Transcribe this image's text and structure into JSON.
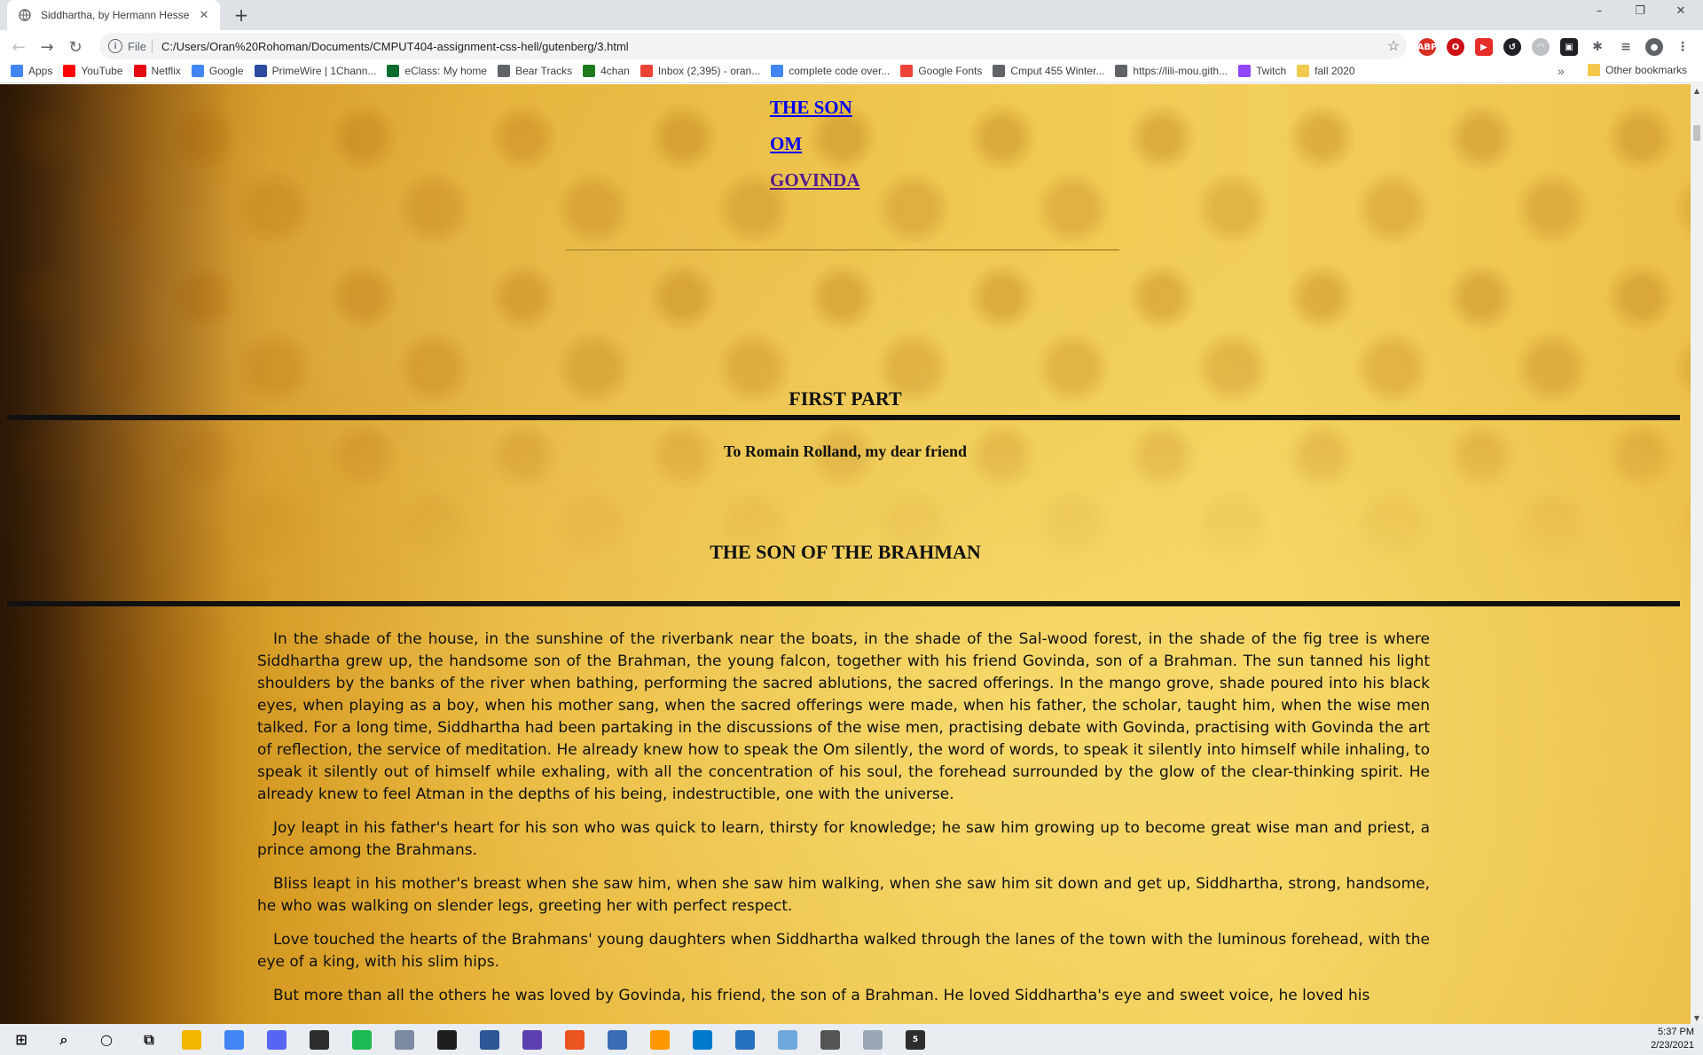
{
  "browser": {
    "tab_title": "Siddhartha, by Hermann Hesse",
    "new_tab_label": "+",
    "window_buttons": [
      "–",
      "❐",
      "✕"
    ],
    "url_scheme": "File",
    "url": "C:/Users/Oran%20Rohoman/Documents/CMPUT404-assignment-css-hell/gutenberg/3.html"
  },
  "bookmarks": [
    {
      "label": "Apps",
      "icon": "apps-grid-icon",
      "color": "#4285f4"
    },
    {
      "label": "YouTube",
      "icon": "youtube-icon",
      "color": "#ff0000"
    },
    {
      "label": "Netflix",
      "icon": "netflix-icon",
      "color": "#e50914"
    },
    {
      "label": "Google",
      "icon": "google-icon",
      "color": "#4285f4"
    },
    {
      "label": "PrimeWire | 1Chann...",
      "icon": "primewire-icon",
      "color": "#2b4aa0"
    },
    {
      "label": "eClass: My home",
      "icon": "eclass-icon",
      "color": "#0a6b2e"
    },
    {
      "label": "Bear Tracks",
      "icon": "globe-icon",
      "color": "#5f6368"
    },
    {
      "label": "4chan",
      "icon": "4chan-icon",
      "color": "#1d7a1d"
    },
    {
      "label": "Inbox (2,395) - oran...",
      "icon": "gmail-icon",
      "color": "#ea4335"
    },
    {
      "label": "complete code over...",
      "icon": "docs-icon",
      "color": "#4285f4"
    },
    {
      "label": "Google Fonts",
      "icon": "google-fonts-icon",
      "color": "#ea4335"
    },
    {
      "label": "Cmput 455 Winter...",
      "icon": "globe-icon",
      "color": "#5f6368"
    },
    {
      "label": "https://lili-mou.gith...",
      "icon": "globe-icon",
      "color": "#5f6368"
    },
    {
      "label": "Twitch",
      "icon": "twitch-icon",
      "color": "#9146ff"
    },
    {
      "label": "fall 2020",
      "icon": "folder-icon",
      "color": "#f2c94c"
    }
  ],
  "bookmarks_more": "»",
  "bookmarks_other": "Other bookmarks",
  "page": {
    "toc": [
      "THE SON",
      "OM",
      "GOVINDA"
    ],
    "part_title": "FIRST PART",
    "dedication": "To Romain Rolland, my dear friend",
    "chapter_title": "THE SON OF THE BRAHMAN",
    "paragraphs": [
      "In the shade of the house, in the sunshine of the riverbank near the boats, in the shade of the Sal-wood forest, in the shade of the fig tree is where Siddhartha grew up, the handsome son of the Brahman, the young falcon, together with his friend Govinda, son of a Brahman. The sun tanned his light shoulders by the banks of the river when bathing, performing the sacred ablutions, the sacred offerings. In the mango grove, shade poured into his black eyes, when playing as a boy, when his mother sang, when the sacred offerings were made, when his father, the scholar, taught him, when the wise men talked. For a long time, Siddhartha had been partaking in the discussions of the wise men, practising debate with Govinda, practising with Govinda the art of reflection, the service of meditation. He already knew how to speak the Om silently, the word of words, to speak it silently into himself while inhaling, to speak it silently out of himself while exhaling, with all the concentration of his soul, the forehead surrounded by the glow of the clear-thinking spirit. He already knew to feel Atman in the depths of his being, indestructible, one with the universe.",
      "Joy leapt in his father's heart for his son who was quick to learn, thirsty for knowledge; he saw him growing up to become great wise man and priest, a prince among the Brahmans.",
      "Bliss leapt in his mother's breast when she saw him, when she saw him walking, when she saw him sit down and get up, Siddhartha, strong, handsome, he who was walking on slender legs, greeting her with perfect respect.",
      "Love touched the hearts of the Brahmans' young daughters when Siddhartha walked through the lanes of the town with the luminous forehead, with the eye of a king, with his slim hips.",
      "But more than all the others he was loved by Govinda, his friend, the son of a Brahman. He loved Siddhartha's eye and sweet voice, he loved his"
    ]
  },
  "taskbar": {
    "time": "5:37 PM",
    "date": "2/23/2021",
    "badge": "5",
    "apps": [
      {
        "name": "windows-start-icon",
        "color": "#111111"
      },
      {
        "name": "search-icon",
        "color": "#111111"
      },
      {
        "name": "cortana-icon",
        "color": "#111111"
      },
      {
        "name": "task-view-icon",
        "color": "#111111"
      },
      {
        "name": "file-explorer-icon",
        "color": "#f2b600"
      },
      {
        "name": "chrome-icon",
        "color": "#4285f4"
      },
      {
        "name": "discord-icon",
        "color": "#5865f2"
      },
      {
        "name": "sticky-notes-icon",
        "color": "#2d2d2d"
      },
      {
        "name": "spotify-icon",
        "color": "#1db954"
      },
      {
        "name": "photos-icon",
        "color": "#7a8aa0"
      },
      {
        "name": "terminal-icon",
        "color": "#1e1e1e"
      },
      {
        "name": "network-icon",
        "color": "#2b5797"
      },
      {
        "name": "obs-icon",
        "color": "#5c3fb0"
      },
      {
        "name": "ubuntu-icon",
        "color": "#e95420"
      },
      {
        "name": "virtualbox-icon",
        "color": "#3b6db4"
      },
      {
        "name": "sublime-icon",
        "color": "#ff9800"
      },
      {
        "name": "vscode-icon",
        "color": "#007acc"
      },
      {
        "name": "powershell-icon",
        "color": "#2671be"
      },
      {
        "name": "files-icon",
        "color": "#6fa8dc"
      },
      {
        "name": "settings-icon",
        "color": "#555555"
      },
      {
        "name": "snipping-icon",
        "color": "#9aa7b5"
      },
      {
        "name": "stack-icon",
        "color": "#2d2d2d"
      }
    ]
  }
}
